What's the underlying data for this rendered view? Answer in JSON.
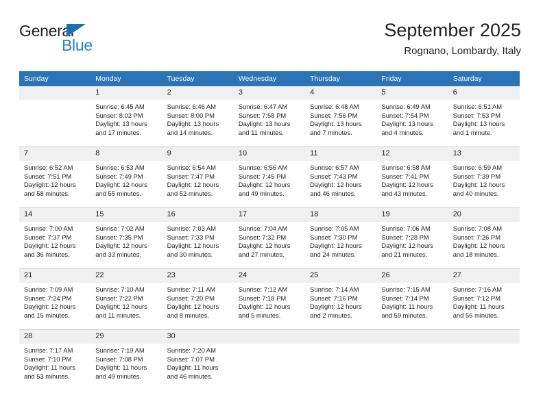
{
  "brand": {
    "name_dark": "General",
    "name_blue": "Blue",
    "accent_color": "#2b7fc3",
    "triangle_color": "#1c6fb5"
  },
  "header": {
    "title": "September 2025",
    "subtitle": "Rognano, Lombardy, Italy"
  },
  "theme": {
    "header_bg": "#2b74b8",
    "daynum_bg": "#f0f0f0",
    "row_divider": "#cfcfcf",
    "text": "#231f20"
  },
  "weekdays": [
    "Sunday",
    "Monday",
    "Tuesday",
    "Wednesday",
    "Thursday",
    "Friday",
    "Saturday"
  ],
  "weeks": [
    [
      {
        "day": "",
        "sunrise": "",
        "sunset": "",
        "daylight1": "",
        "daylight2": "",
        "blank": true
      },
      {
        "day": "1",
        "sunrise": "Sunrise: 6:45 AM",
        "sunset": "Sunset: 8:02 PM",
        "daylight1": "Daylight: 13 hours",
        "daylight2": "and 17 minutes."
      },
      {
        "day": "2",
        "sunrise": "Sunrise: 6:46 AM",
        "sunset": "Sunset: 8:00 PM",
        "daylight1": "Daylight: 13 hours",
        "daylight2": "and 14 minutes."
      },
      {
        "day": "3",
        "sunrise": "Sunrise: 6:47 AM",
        "sunset": "Sunset: 7:58 PM",
        "daylight1": "Daylight: 13 hours",
        "daylight2": "and 11 minutes."
      },
      {
        "day": "4",
        "sunrise": "Sunrise: 6:48 AM",
        "sunset": "Sunset: 7:56 PM",
        "daylight1": "Daylight: 13 hours",
        "daylight2": "and 7 minutes."
      },
      {
        "day": "5",
        "sunrise": "Sunrise: 6:49 AM",
        "sunset": "Sunset: 7:54 PM",
        "daylight1": "Daylight: 13 hours",
        "daylight2": "and 4 minutes."
      },
      {
        "day": "6",
        "sunrise": "Sunrise: 6:51 AM",
        "sunset": "Sunset: 7:53 PM",
        "daylight1": "Daylight: 13 hours",
        "daylight2": "and 1 minute."
      }
    ],
    [
      {
        "day": "7",
        "sunrise": "Sunrise: 6:52 AM",
        "sunset": "Sunset: 7:51 PM",
        "daylight1": "Daylight: 12 hours",
        "daylight2": "and 58 minutes."
      },
      {
        "day": "8",
        "sunrise": "Sunrise: 6:53 AM",
        "sunset": "Sunset: 7:49 PM",
        "daylight1": "Daylight: 12 hours",
        "daylight2": "and 55 minutes."
      },
      {
        "day": "9",
        "sunrise": "Sunrise: 6:54 AM",
        "sunset": "Sunset: 7:47 PM",
        "daylight1": "Daylight: 12 hours",
        "daylight2": "and 52 minutes."
      },
      {
        "day": "10",
        "sunrise": "Sunrise: 6:56 AM",
        "sunset": "Sunset: 7:45 PM",
        "daylight1": "Daylight: 12 hours",
        "daylight2": "and 49 minutes."
      },
      {
        "day": "11",
        "sunrise": "Sunrise: 6:57 AM",
        "sunset": "Sunset: 7:43 PM",
        "daylight1": "Daylight: 12 hours",
        "daylight2": "and 46 minutes."
      },
      {
        "day": "12",
        "sunrise": "Sunrise: 6:58 AM",
        "sunset": "Sunset: 7:41 PM",
        "daylight1": "Daylight: 12 hours",
        "daylight2": "and 43 minutes."
      },
      {
        "day": "13",
        "sunrise": "Sunrise: 6:59 AM",
        "sunset": "Sunset: 7:39 PM",
        "daylight1": "Daylight: 12 hours",
        "daylight2": "and 40 minutes."
      }
    ],
    [
      {
        "day": "14",
        "sunrise": "Sunrise: 7:00 AM",
        "sunset": "Sunset: 7:37 PM",
        "daylight1": "Daylight: 12 hours",
        "daylight2": "and 36 minutes."
      },
      {
        "day": "15",
        "sunrise": "Sunrise: 7:02 AM",
        "sunset": "Sunset: 7:35 PM",
        "daylight1": "Daylight: 12 hours",
        "daylight2": "and 33 minutes."
      },
      {
        "day": "16",
        "sunrise": "Sunrise: 7:03 AM",
        "sunset": "Sunset: 7:33 PM",
        "daylight1": "Daylight: 12 hours",
        "daylight2": "and 30 minutes."
      },
      {
        "day": "17",
        "sunrise": "Sunrise: 7:04 AM",
        "sunset": "Sunset: 7:32 PM",
        "daylight1": "Daylight: 12 hours",
        "daylight2": "and 27 minutes."
      },
      {
        "day": "18",
        "sunrise": "Sunrise: 7:05 AM",
        "sunset": "Sunset: 7:30 PM",
        "daylight1": "Daylight: 12 hours",
        "daylight2": "and 24 minutes."
      },
      {
        "day": "19",
        "sunrise": "Sunrise: 7:06 AM",
        "sunset": "Sunset: 7:28 PM",
        "daylight1": "Daylight: 12 hours",
        "daylight2": "and 21 minutes."
      },
      {
        "day": "20",
        "sunrise": "Sunrise: 7:08 AM",
        "sunset": "Sunset: 7:26 PM",
        "daylight1": "Daylight: 12 hours",
        "daylight2": "and 18 minutes."
      }
    ],
    [
      {
        "day": "21",
        "sunrise": "Sunrise: 7:09 AM",
        "sunset": "Sunset: 7:24 PM",
        "daylight1": "Daylight: 12 hours",
        "daylight2": "and 15 minutes."
      },
      {
        "day": "22",
        "sunrise": "Sunrise: 7:10 AM",
        "sunset": "Sunset: 7:22 PM",
        "daylight1": "Daylight: 12 hours",
        "daylight2": "and 11 minutes."
      },
      {
        "day": "23",
        "sunrise": "Sunrise: 7:11 AM",
        "sunset": "Sunset: 7:20 PM",
        "daylight1": "Daylight: 12 hours",
        "daylight2": "and 8 minutes."
      },
      {
        "day": "24",
        "sunrise": "Sunrise: 7:12 AM",
        "sunset": "Sunset: 7:18 PM",
        "daylight1": "Daylight: 12 hours",
        "daylight2": "and 5 minutes."
      },
      {
        "day": "25",
        "sunrise": "Sunrise: 7:14 AM",
        "sunset": "Sunset: 7:16 PM",
        "daylight1": "Daylight: 12 hours",
        "daylight2": "and 2 minutes."
      },
      {
        "day": "26",
        "sunrise": "Sunrise: 7:15 AM",
        "sunset": "Sunset: 7:14 PM",
        "daylight1": "Daylight: 11 hours",
        "daylight2": "and 59 minutes."
      },
      {
        "day": "27",
        "sunrise": "Sunrise: 7:16 AM",
        "sunset": "Sunset: 7:12 PM",
        "daylight1": "Daylight: 11 hours",
        "daylight2": "and 56 minutes."
      }
    ],
    [
      {
        "day": "28",
        "sunrise": "Sunrise: 7:17 AM",
        "sunset": "Sunset: 7:10 PM",
        "daylight1": "Daylight: 11 hours",
        "daylight2": "and 53 minutes."
      },
      {
        "day": "29",
        "sunrise": "Sunrise: 7:19 AM",
        "sunset": "Sunset: 7:08 PM",
        "daylight1": "Daylight: 11 hours",
        "daylight2": "and 49 minutes."
      },
      {
        "day": "30",
        "sunrise": "Sunrise: 7:20 AM",
        "sunset": "Sunset: 7:07 PM",
        "daylight1": "Daylight: 11 hours",
        "daylight2": "and 46 minutes."
      },
      {
        "day": "",
        "sunrise": "",
        "sunset": "",
        "daylight1": "",
        "daylight2": "",
        "blank": true
      },
      {
        "day": "",
        "sunrise": "",
        "sunset": "",
        "daylight1": "",
        "daylight2": "",
        "blank": true
      },
      {
        "day": "",
        "sunrise": "",
        "sunset": "",
        "daylight1": "",
        "daylight2": "",
        "blank": true
      },
      {
        "day": "",
        "sunrise": "",
        "sunset": "",
        "daylight1": "",
        "daylight2": "",
        "blank": true
      }
    ]
  ]
}
